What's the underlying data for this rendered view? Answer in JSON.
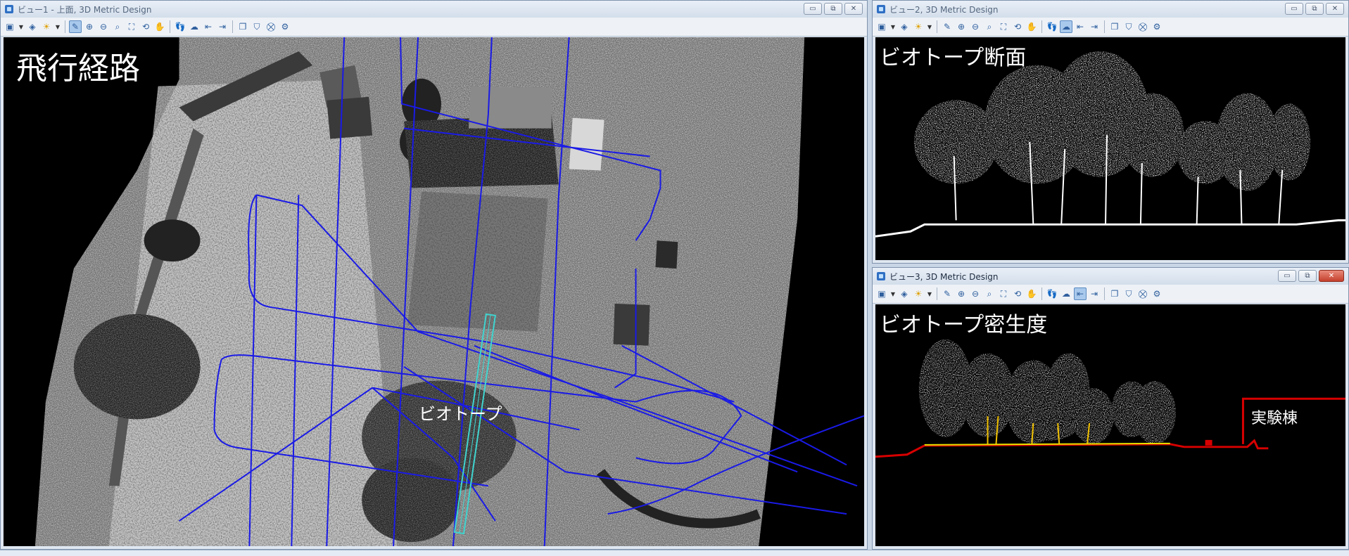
{
  "windows": {
    "view1": {
      "title": "ビュー1 - 上面, 3D Metric Design",
      "label_main": "飛行経路",
      "label_biotope": "ビオトープ"
    },
    "view2": {
      "title": "ビュー2, 3D Metric Design",
      "label_main": "ビオトープ断面"
    },
    "view3": {
      "title": "ビュー3, 3D Metric Design",
      "label_main": "ビオトープ密生度",
      "label_building": "実験棟"
    }
  },
  "window_controls": {
    "minimize": "▭",
    "restore": "⧉",
    "close": "✕"
  },
  "toolbar_icons": [
    "view-settings-icon",
    "dropdown-arrow",
    "level-display-icon",
    "render-icon",
    "dropdown-arrow",
    "update-view-icon",
    "zoom-in-icon",
    "zoom-out-icon",
    "window-area-icon",
    "fit-view-icon",
    "rotate-view-icon",
    "pan-view-icon",
    "walk-icon",
    "fly-icon",
    "previous-view-icon",
    "next-view-icon",
    "copy-view-icon",
    "clip-volume-icon",
    "clip-mask-icon",
    "display-style-icon"
  ],
  "colors": {
    "flight_path": "#1a1ae6",
    "biotope_outline": "#3fd4cf",
    "section_ground_red": "#d80000",
    "background": "#000000"
  }
}
